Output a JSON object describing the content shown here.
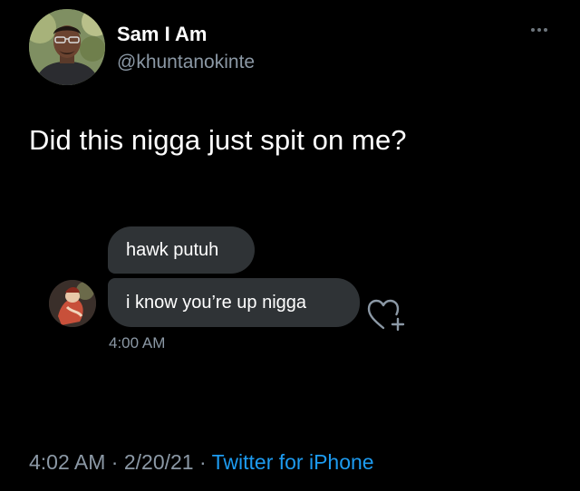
{
  "user": {
    "display_name": "Sam I Am",
    "handle": "@khuntanokinte"
  },
  "header": {
    "more_icon": "more-horizontal-icon"
  },
  "tweet": {
    "text": "Did this nigga just spit on me?"
  },
  "dm": {
    "messages": [
      {
        "text": "hawk putuh"
      },
      {
        "text": "i know you’re up nigga"
      }
    ],
    "timestamp": "4:00 AM",
    "react_icon": "heart-plus-icon"
  },
  "footer": {
    "time": "4:02 AM",
    "separator": " · ",
    "date": "2/20/21",
    "source": "Twitter for iPhone"
  },
  "colors": {
    "background": "#000000",
    "bubble": "#2f3336",
    "secondary_text": "#8b98a5",
    "link": "#1d9bf0"
  }
}
